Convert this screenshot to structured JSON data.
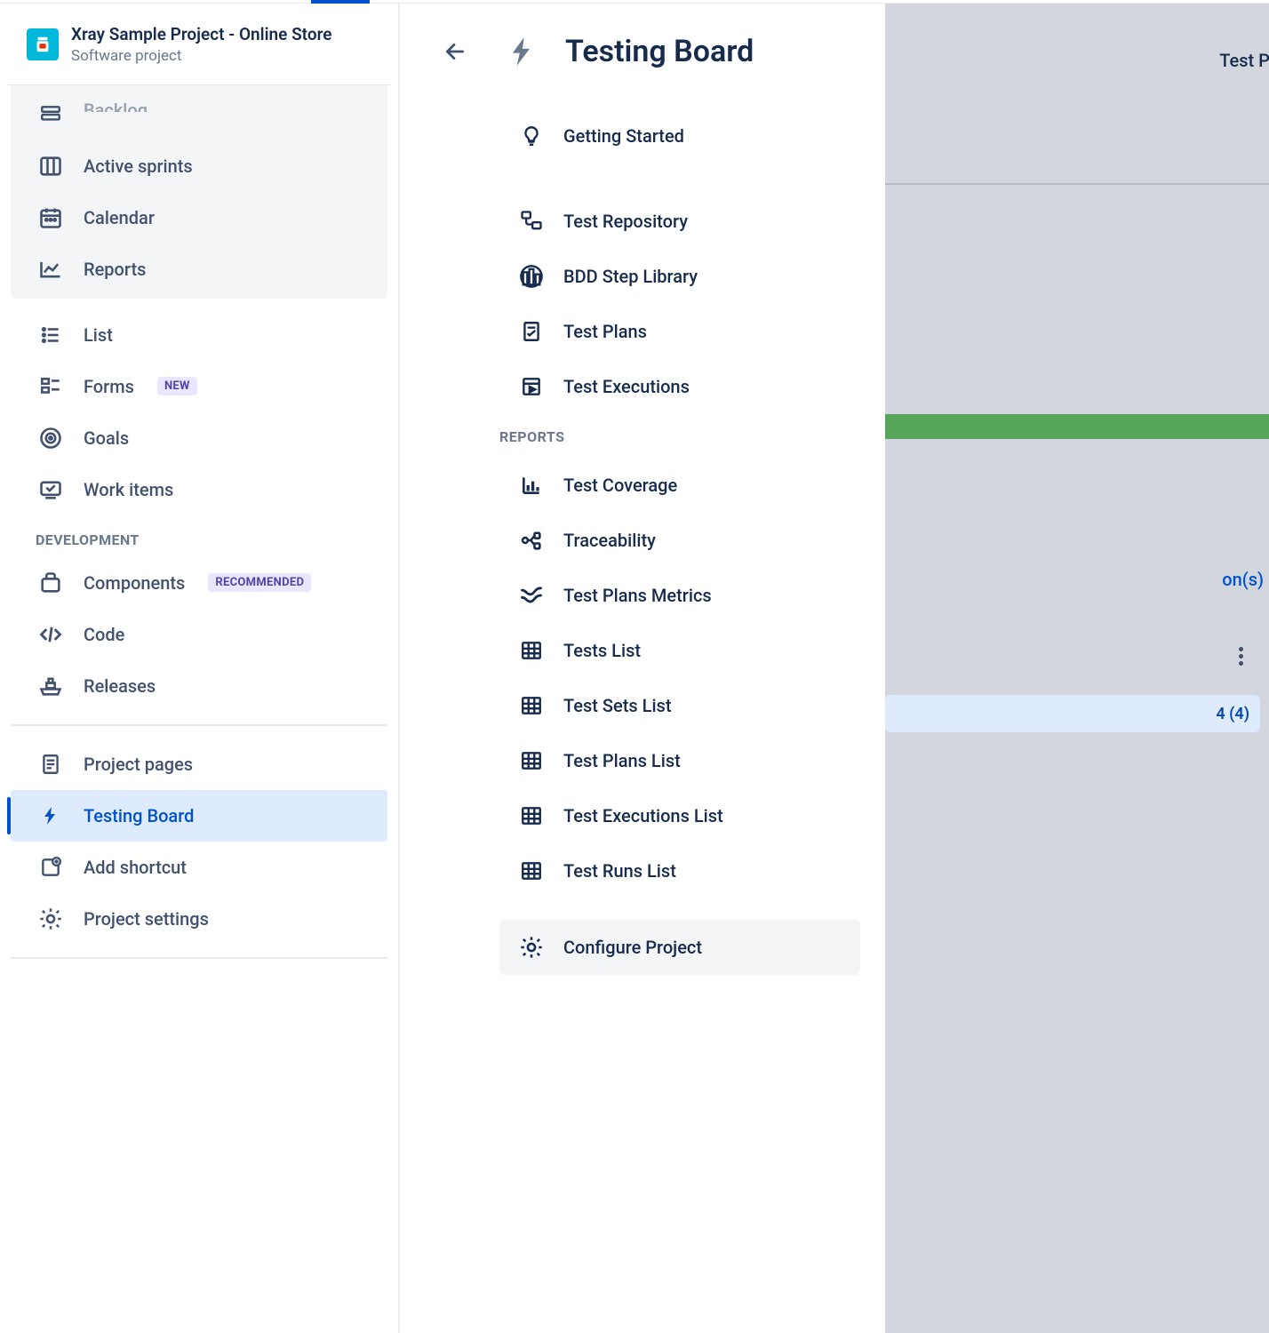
{
  "project": {
    "title": "Xray Sample Project - Online Store",
    "subtitle": "Software project"
  },
  "sidebar": {
    "groupA": {
      "backlog": "Backlog",
      "active_sprints": "Active sprints",
      "calendar": "Calendar",
      "reports": "Reports"
    },
    "list": "List",
    "forms": "Forms",
    "forms_badge": "NEW",
    "goals": "Goals",
    "work_items": "Work items",
    "section_dev": "DEVELOPMENT",
    "components": "Components",
    "components_badge": "RECOMMENDED",
    "code": "Code",
    "releases": "Releases",
    "project_pages": "Project pages",
    "testing_board": "Testing Board",
    "add_shortcut": "Add shortcut",
    "project_settings": "Project settings"
  },
  "panel": {
    "title": "Testing Board",
    "getting_started": "Getting Started",
    "test_repository": "Test Repository",
    "bdd_step_library": "BDD Step Library",
    "test_plans": "Test Plans",
    "test_executions": "Test Executions",
    "section_reports": "REPORTS",
    "test_coverage": "Test Coverage",
    "traceability": "Traceability",
    "test_plans_metrics": "Test Plans Metrics",
    "tests_list": "Tests List",
    "test_sets_list": "Test Sets List",
    "test_plans_list": "Test Plans List",
    "test_executions_list": "Test Executions List",
    "test_runs_list": "Test Runs List",
    "configure_project": "Configure Project"
  },
  "bg": {
    "text1": "Test Pl",
    "text2": "on(s)",
    "card": "4 (4)"
  }
}
